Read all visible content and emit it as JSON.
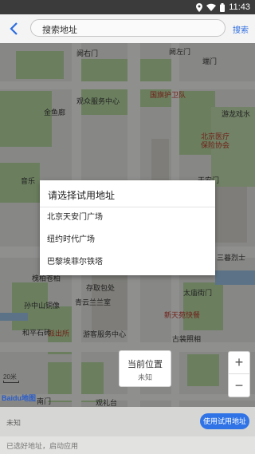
{
  "status_bar": {
    "time": "11:43",
    "icons": [
      "location-icon",
      "wifi-icon",
      "battery-icon"
    ]
  },
  "toolbar": {
    "back_icon": "chevron-left-icon",
    "search_placeholder": "搜索地址",
    "search_button": "搜索"
  },
  "map": {
    "labels": [
      {
        "text": "阙右门"
      },
      {
        "text": "阙左门"
      },
      {
        "text": "国旗护卫队",
        "red": true
      },
      {
        "text": "端门"
      },
      {
        "text": "金鱼廊"
      },
      {
        "text": "观众服务中心"
      },
      {
        "text": "游龙戏水"
      },
      {
        "text": "北京医疗",
        "red": true
      },
      {
        "text": "保险协会",
        "red": true
      },
      {
        "text": "音乐"
      },
      {
        "text": "天安门"
      },
      {
        "text": "三暮烈士"
      },
      {
        "text": "槐柏苍柏"
      },
      {
        "text": "存取包处"
      },
      {
        "text": "孙中山铜像"
      },
      {
        "text": "青云兰兰室"
      },
      {
        "text": "太庙街门"
      },
      {
        "text": "新天苑快餐",
        "red": true
      },
      {
        "text": "和平石砖"
      },
      {
        "text": "古装照相"
      },
      {
        "text": "派出所",
        "red": true
      },
      {
        "text": "游客服务中心"
      },
      {
        "text": "南门"
      },
      {
        "text": "观礼台"
      }
    ],
    "marker": {
      "title": "当前位置",
      "subtitle": "未知"
    },
    "zoom_in": "+",
    "zoom_out": "−",
    "scale": "20米",
    "logo": "Baidu地图"
  },
  "dialog": {
    "title": "请选择试用地址",
    "items": [
      "北京天安门广场",
      "纽约时代广场",
      "巴黎埃菲尔铁塔"
    ]
  },
  "bottom": {
    "address": "未知",
    "use_button": "使用试用地址"
  },
  "footer": {
    "hint": "已选好地址，启动应用"
  }
}
